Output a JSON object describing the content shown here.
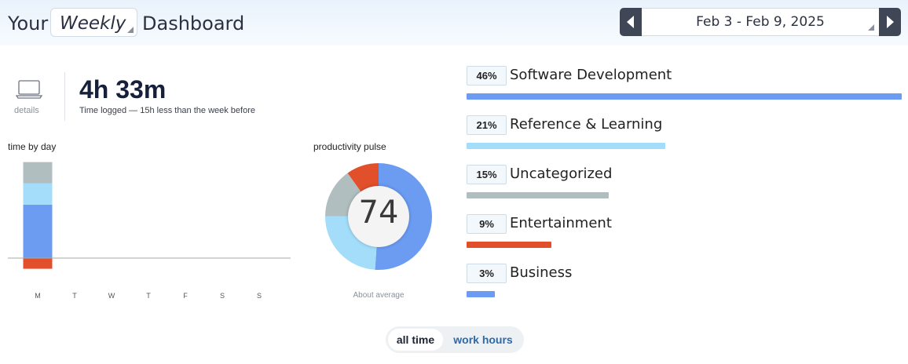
{
  "header": {
    "title_prefix": "Your",
    "period": "Weekly",
    "title_suffix": "Dashboard",
    "date_range": "Feb 3 - Feb 9, 2025"
  },
  "summary": {
    "details_label": "details",
    "total_time": "4h 33m",
    "caption": "Time logged — 15h less than the week before"
  },
  "time_by_day": {
    "label": "time by day",
    "days": [
      "M",
      "T",
      "W",
      "T",
      "F",
      "S",
      "S"
    ]
  },
  "pulse": {
    "label": "productivity pulse",
    "score": "74",
    "caption": "About average"
  },
  "colors": {
    "very_productive": "#6b9cf2",
    "productive": "#a3ddfa",
    "neutral": "#b1bebf",
    "distracting": "#e1502a"
  },
  "categories": [
    {
      "pct": "46%",
      "name": "Software Development",
      "share": 0.46,
      "color": "#6b9cf2"
    },
    {
      "pct": "21%",
      "name": "Reference & Learning",
      "share": 0.21,
      "color": "#a3ddfa"
    },
    {
      "pct": "15%",
      "name": "Uncategorized",
      "share": 0.15,
      "color": "#b1bebf"
    },
    {
      "pct": "9%",
      "name": "Entertainment",
      "share": 0.09,
      "color": "#e1502a"
    },
    {
      "pct": "3%",
      "name": "Business",
      "share": 0.03,
      "color": "#6b9cf2"
    }
  ],
  "chart_data": {
    "type": "bar",
    "categories": [
      "M",
      "T",
      "W",
      "T",
      "F",
      "S",
      "S"
    ],
    "series": [
      {
        "values": [
          2.0,
          0,
          0,
          0,
          0,
          0,
          0
        ],
        "color": "#6b9cf2"
      },
      {
        "values": [
          0.8,
          0,
          0,
          0,
          0,
          0,
          0
        ],
        "color": "#a3ddfa"
      },
      {
        "values": [
          0.8,
          0,
          0,
          0,
          0,
          0,
          0
        ],
        "color": "#b1bebf"
      },
      {
        "values": [
          -0.4,
          0,
          0,
          0,
          0,
          0,
          0
        ],
        "color": "#e1502a"
      }
    ]
  },
  "pulse_chart": {
    "type": "pie",
    "values": [
      0.51,
      0.24,
      0.15,
      0.1
    ],
    "colors": [
      "#6b9cf2",
      "#a3ddfa",
      "#b1bebf",
      "#e1502a"
    ]
  },
  "toggle": {
    "all_time": "all time",
    "work_hours": "work hours"
  }
}
